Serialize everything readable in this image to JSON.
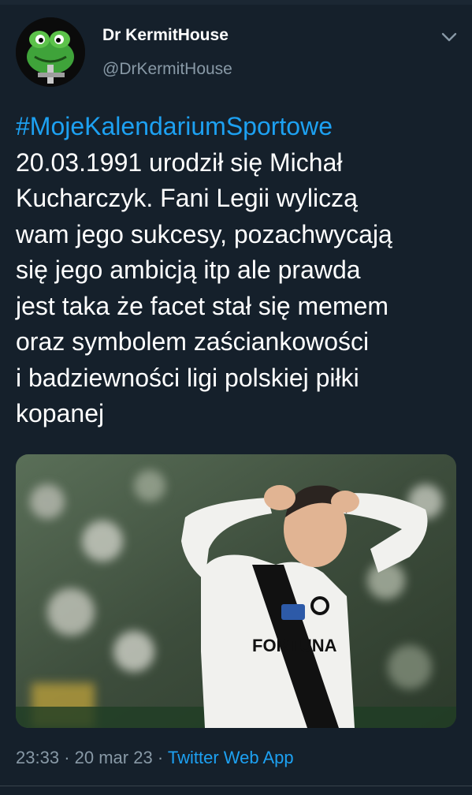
{
  "author": {
    "display_name": "Dr KermitHouse",
    "handle": "@DrKermitHouse",
    "avatar_icon": "kermit-avatar"
  },
  "tweet": {
    "hashtag": "#MojeKalendariumSportowe",
    "lines": [
      "20.03.1991 urodził się Michał",
      "Kucharczyk. Fani Legii wyliczą",
      "wam jego sukcesy, pozachwycają",
      "się jego ambicją itp ale prawda",
      "jest taka że facet stał się memem",
      "oraz symbolem zaściankowości",
      "i badziewności ligi polskiej piłki",
      "kopanej"
    ]
  },
  "media": {
    "shirt_text": "FORTUNA",
    "kind": "photo-footballer-hands-on-head"
  },
  "meta": {
    "time": "23:33",
    "separator": "·",
    "date": "20 mar 23",
    "source": "Twitter Web App"
  },
  "colors": {
    "background": "#15202b",
    "link": "#1da1f2",
    "secondary_text": "#8899a6"
  }
}
